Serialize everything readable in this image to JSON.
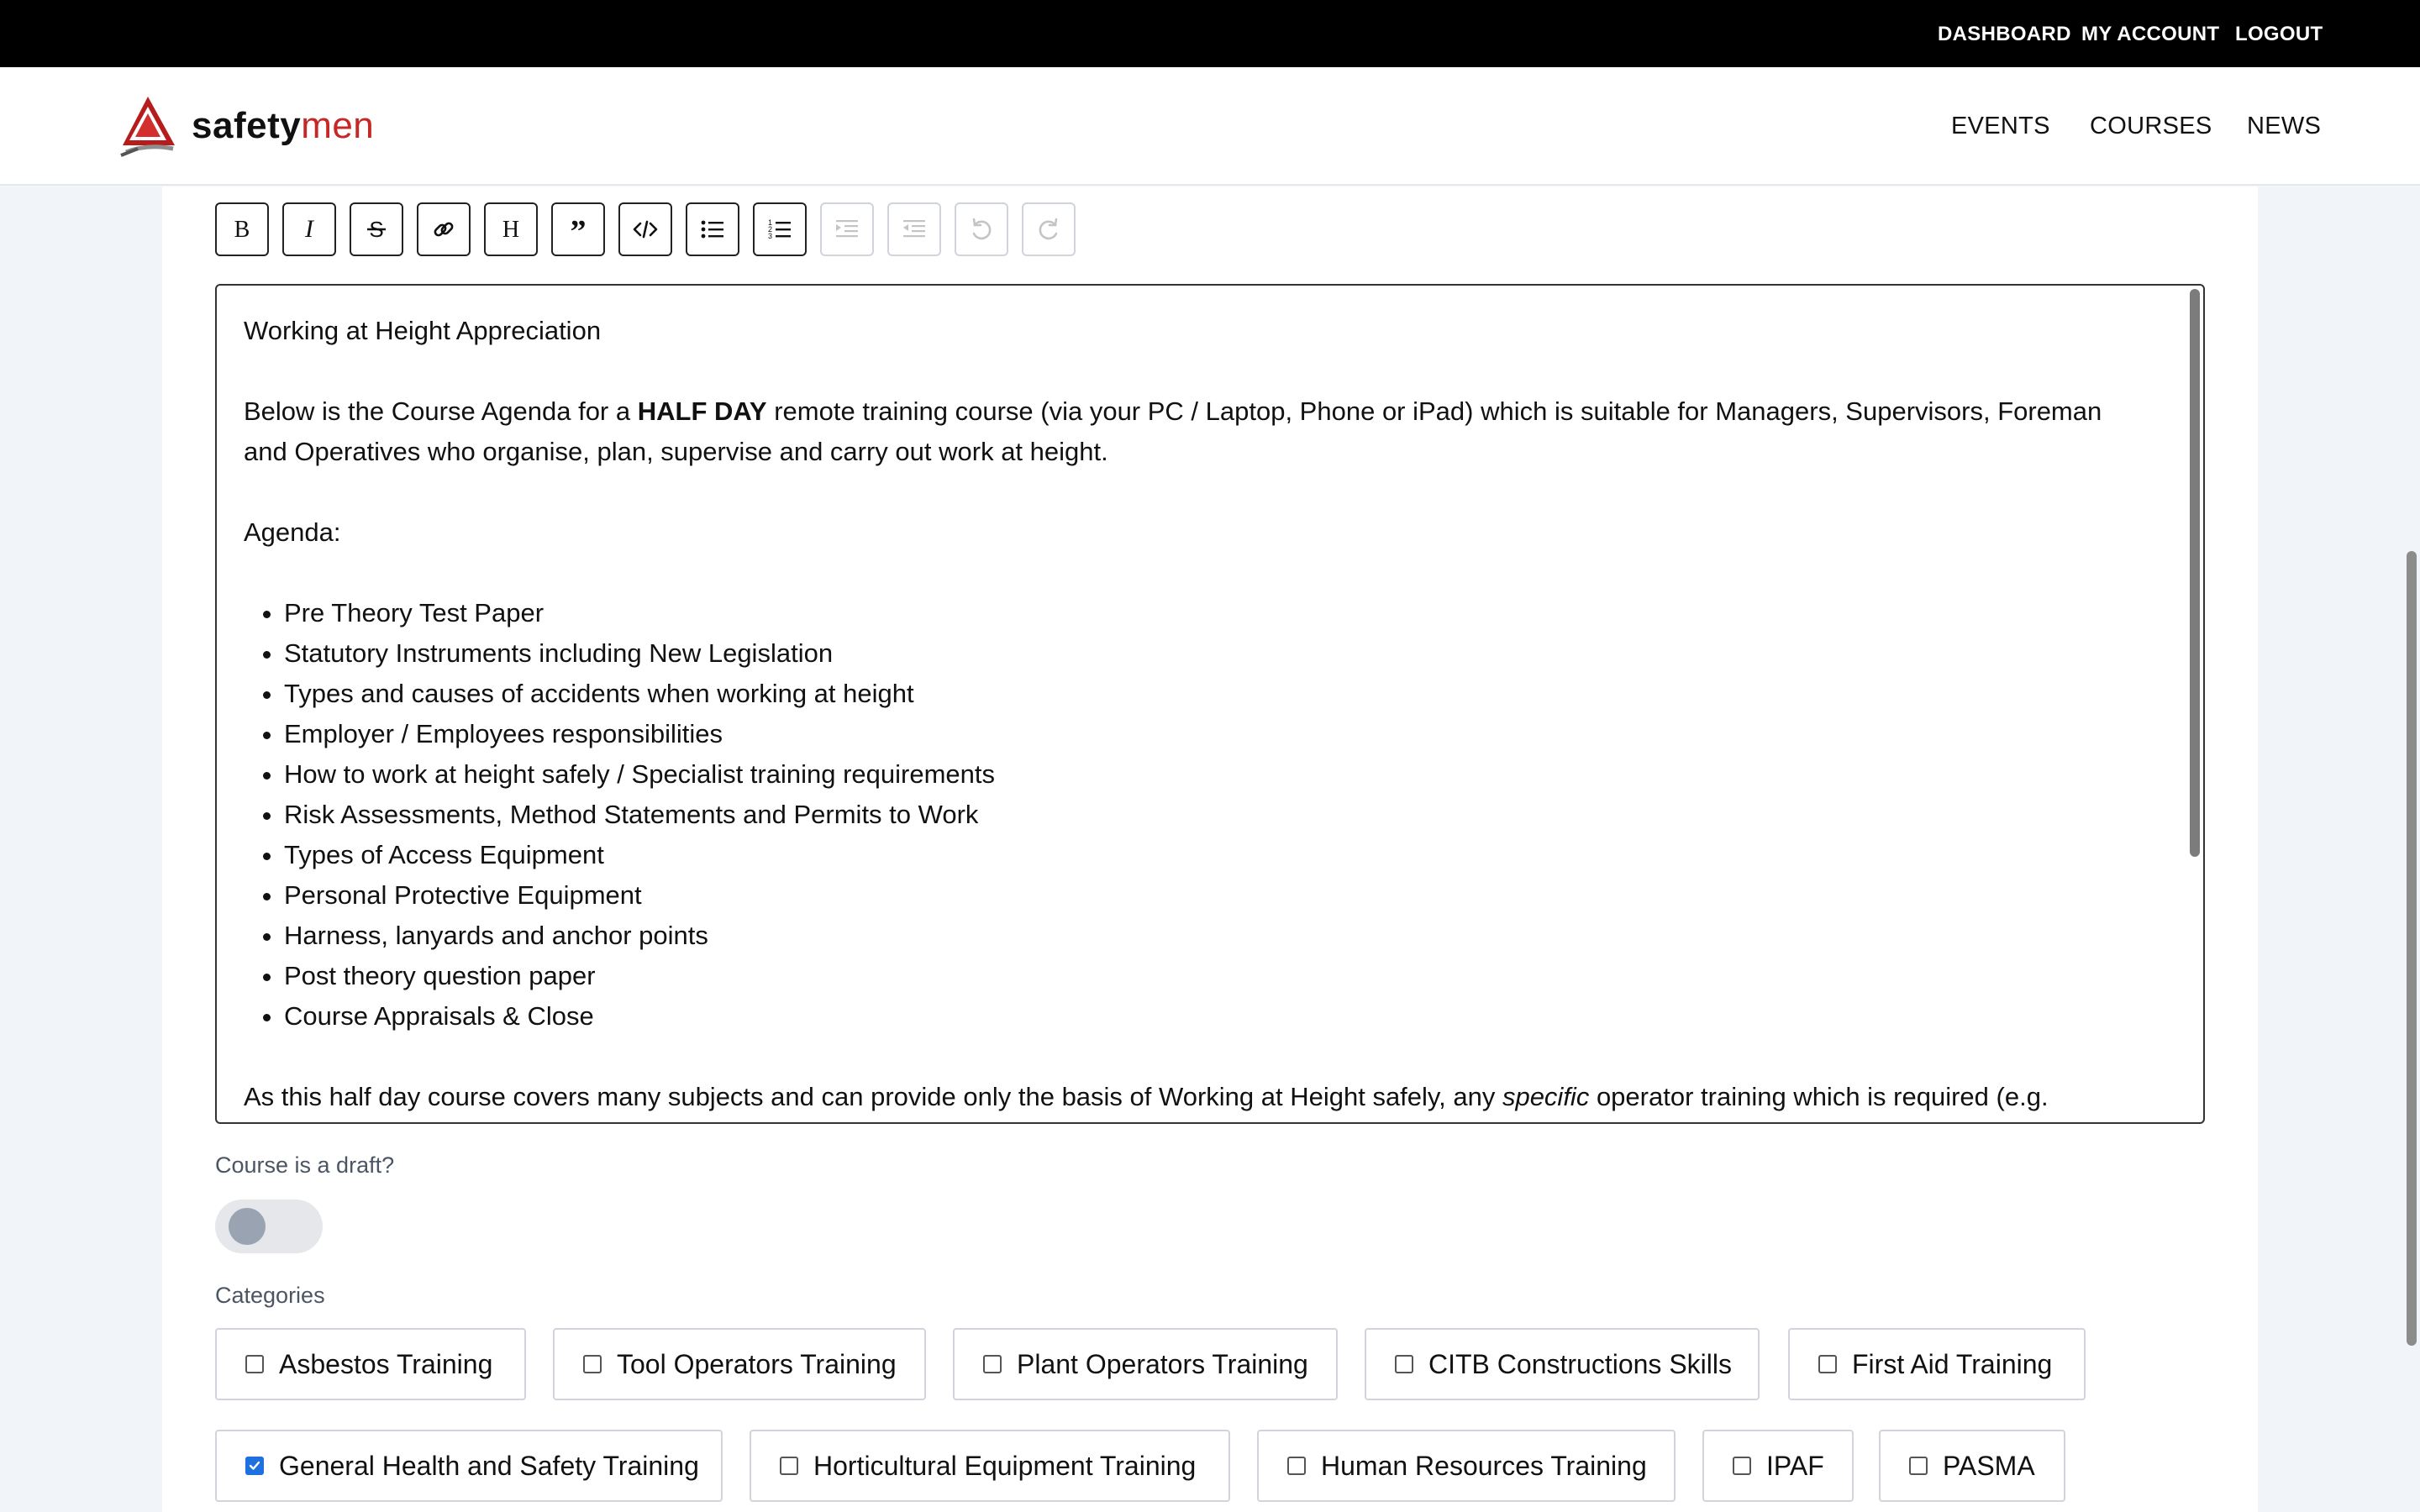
{
  "topbar": {
    "dashboard": "DASHBOARD",
    "my_account": "MY ACCOUNT",
    "logout": "LOGOUT"
  },
  "header": {
    "brand_bold": "safety",
    "brand_light": "men",
    "nav": {
      "events": "EVENTS",
      "courses": "COURSES",
      "news": "NEWS"
    }
  },
  "toolbar": {
    "buttons": [
      "bold-icon",
      "italic-icon",
      "strikethrough-icon",
      "link-icon",
      "heading-icon",
      "blockquote-icon",
      "code-icon",
      "bullet-list-icon",
      "ordered-list-icon",
      "indent-icon",
      "outdent-icon",
      "undo-icon",
      "redo-icon"
    ],
    "disabled": [
      "indent-icon",
      "outdent-icon",
      "undo-icon",
      "redo-icon"
    ]
  },
  "editor": {
    "title": "Working at Height Appreciation",
    "intro_before": "Below is the Course Agenda for a ",
    "intro_bold": "HALF DAY",
    "intro_after": " remote training course (via your PC / Laptop, Phone or iPad) which is suitable for Managers, Supervisors, Foreman and Operatives who organise, plan, supervise and carry out work at height.",
    "agenda_label": "Agenda:",
    "agenda": [
      "Pre Theory Test Paper",
      "Statutory Instruments including New Legislation",
      "Types and causes of accidents when working at height",
      "Employer / Employees responsibilities",
      "How to work at height safely / Specialist training requirements",
      "Risk Assessments, Method Statements and Permits to Work",
      "Types of Access Equipment",
      "Personal Protective Equipment",
      "Harness, lanyards and anchor points",
      "Post theory question paper",
      "Course Appraisals & Close"
    ],
    "closing_before": "As this half day course covers many subjects and can provide only the basis of Working at Height safely, any ",
    "closing_italic": "specific",
    "closing_after": " operator training which is required (e.g."
  },
  "draft": {
    "label": "Course is a draft?",
    "checked": false
  },
  "categories": {
    "label": "Categories",
    "items": [
      {
        "label": "Asbestos Training",
        "checked": false
      },
      {
        "label": "Tool Operators Training",
        "checked": false
      },
      {
        "label": "Plant Operators Training",
        "checked": false
      },
      {
        "label": "CITB Constructions Skills",
        "checked": false
      },
      {
        "label": "First Aid Training",
        "checked": false
      },
      {
        "label": "General Health and Safety Training",
        "checked": true
      },
      {
        "label": "Horticultural Equipment Training",
        "checked": false
      },
      {
        "label": "Human Resources Training",
        "checked": false
      },
      {
        "label": "IPAF",
        "checked": false
      },
      {
        "label": "PASMA",
        "checked": false
      }
    ]
  },
  "colors": {
    "topbar": "#000000",
    "brand_red": "#c62828",
    "checkbox_checked": "#1e6fe0"
  }
}
